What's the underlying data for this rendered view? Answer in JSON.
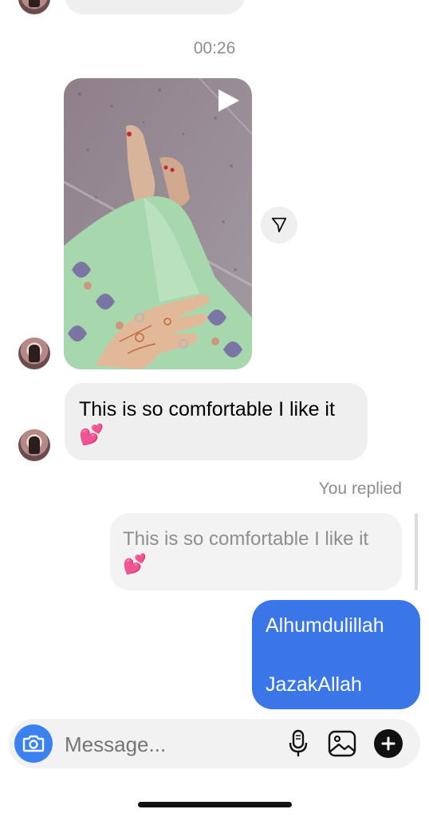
{
  "thread": {
    "timestamp": "00:26",
    "incoming_message": "This is so comfortable I like it💕",
    "you_replied_label": "You replied",
    "quoted_reply": "This is so comfortable I like it 💕",
    "outgoing_line1": "Alhumdulillah",
    "outgoing_line2": "JazakAllah"
  },
  "composer": {
    "placeholder": "Message..."
  },
  "colors": {
    "accent_blue": "#3b82f0",
    "outgoing_bubble": "#3b76e8",
    "bubble_gray": "#efefef"
  },
  "icons": [
    "play-icon",
    "share-icon",
    "camera-icon",
    "microphone-icon",
    "gallery-icon",
    "plus-icon"
  ]
}
